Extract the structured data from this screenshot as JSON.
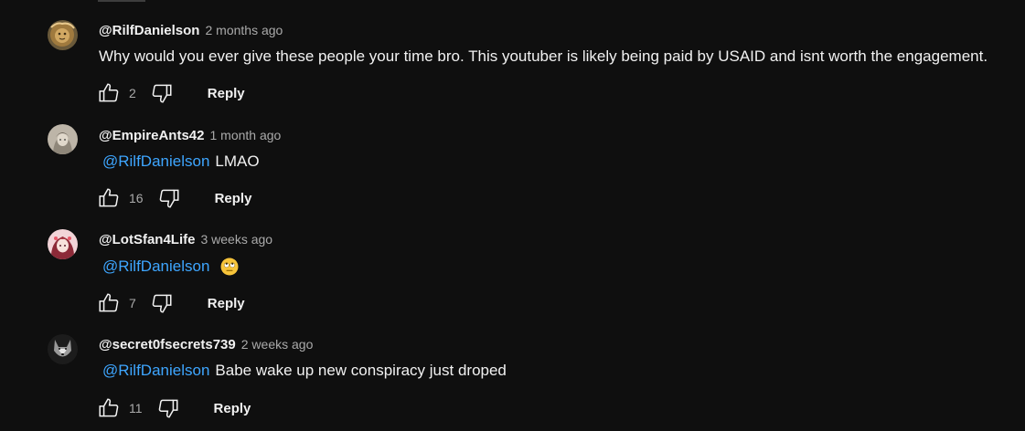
{
  "comments": [
    {
      "author": "@RilfDanielson",
      "time": "2 months ago",
      "mention": "",
      "text": "Why would you ever give these people your time bro. This youtuber is likely being paid by USAID and isnt worth the engagement.",
      "likes": "2",
      "reply_label": "Reply",
      "avatar_icon": "lion-avatar"
    },
    {
      "author": "@EmpireAnts42",
      "time": "1 month ago",
      "mention": "@RilfDanielson",
      "text": "LMAO",
      "likes": "16",
      "reply_label": "Reply",
      "avatar_icon": "anime-portrait-avatar"
    },
    {
      "author": "@LotSfan4Life",
      "time": "3 weeks ago",
      "mention": "@RilfDanielson",
      "text": "",
      "emoji": "eye-roll-emoji",
      "likes": "7",
      "reply_label": "Reply",
      "avatar_icon": "anime-girl-avatar"
    },
    {
      "author": "@secret0fsecrets739",
      "time": "2 weeks ago",
      "mention": "@RilfDanielson",
      "text": "Babe wake up new conspiracy just droped",
      "likes": "11",
      "reply_label": "Reply",
      "avatar_icon": "wolf-avatar"
    }
  ],
  "colors": {
    "background": "#0f0f0f",
    "mention": "#3ea6ff",
    "secondary_text": "#aaaaaa"
  }
}
